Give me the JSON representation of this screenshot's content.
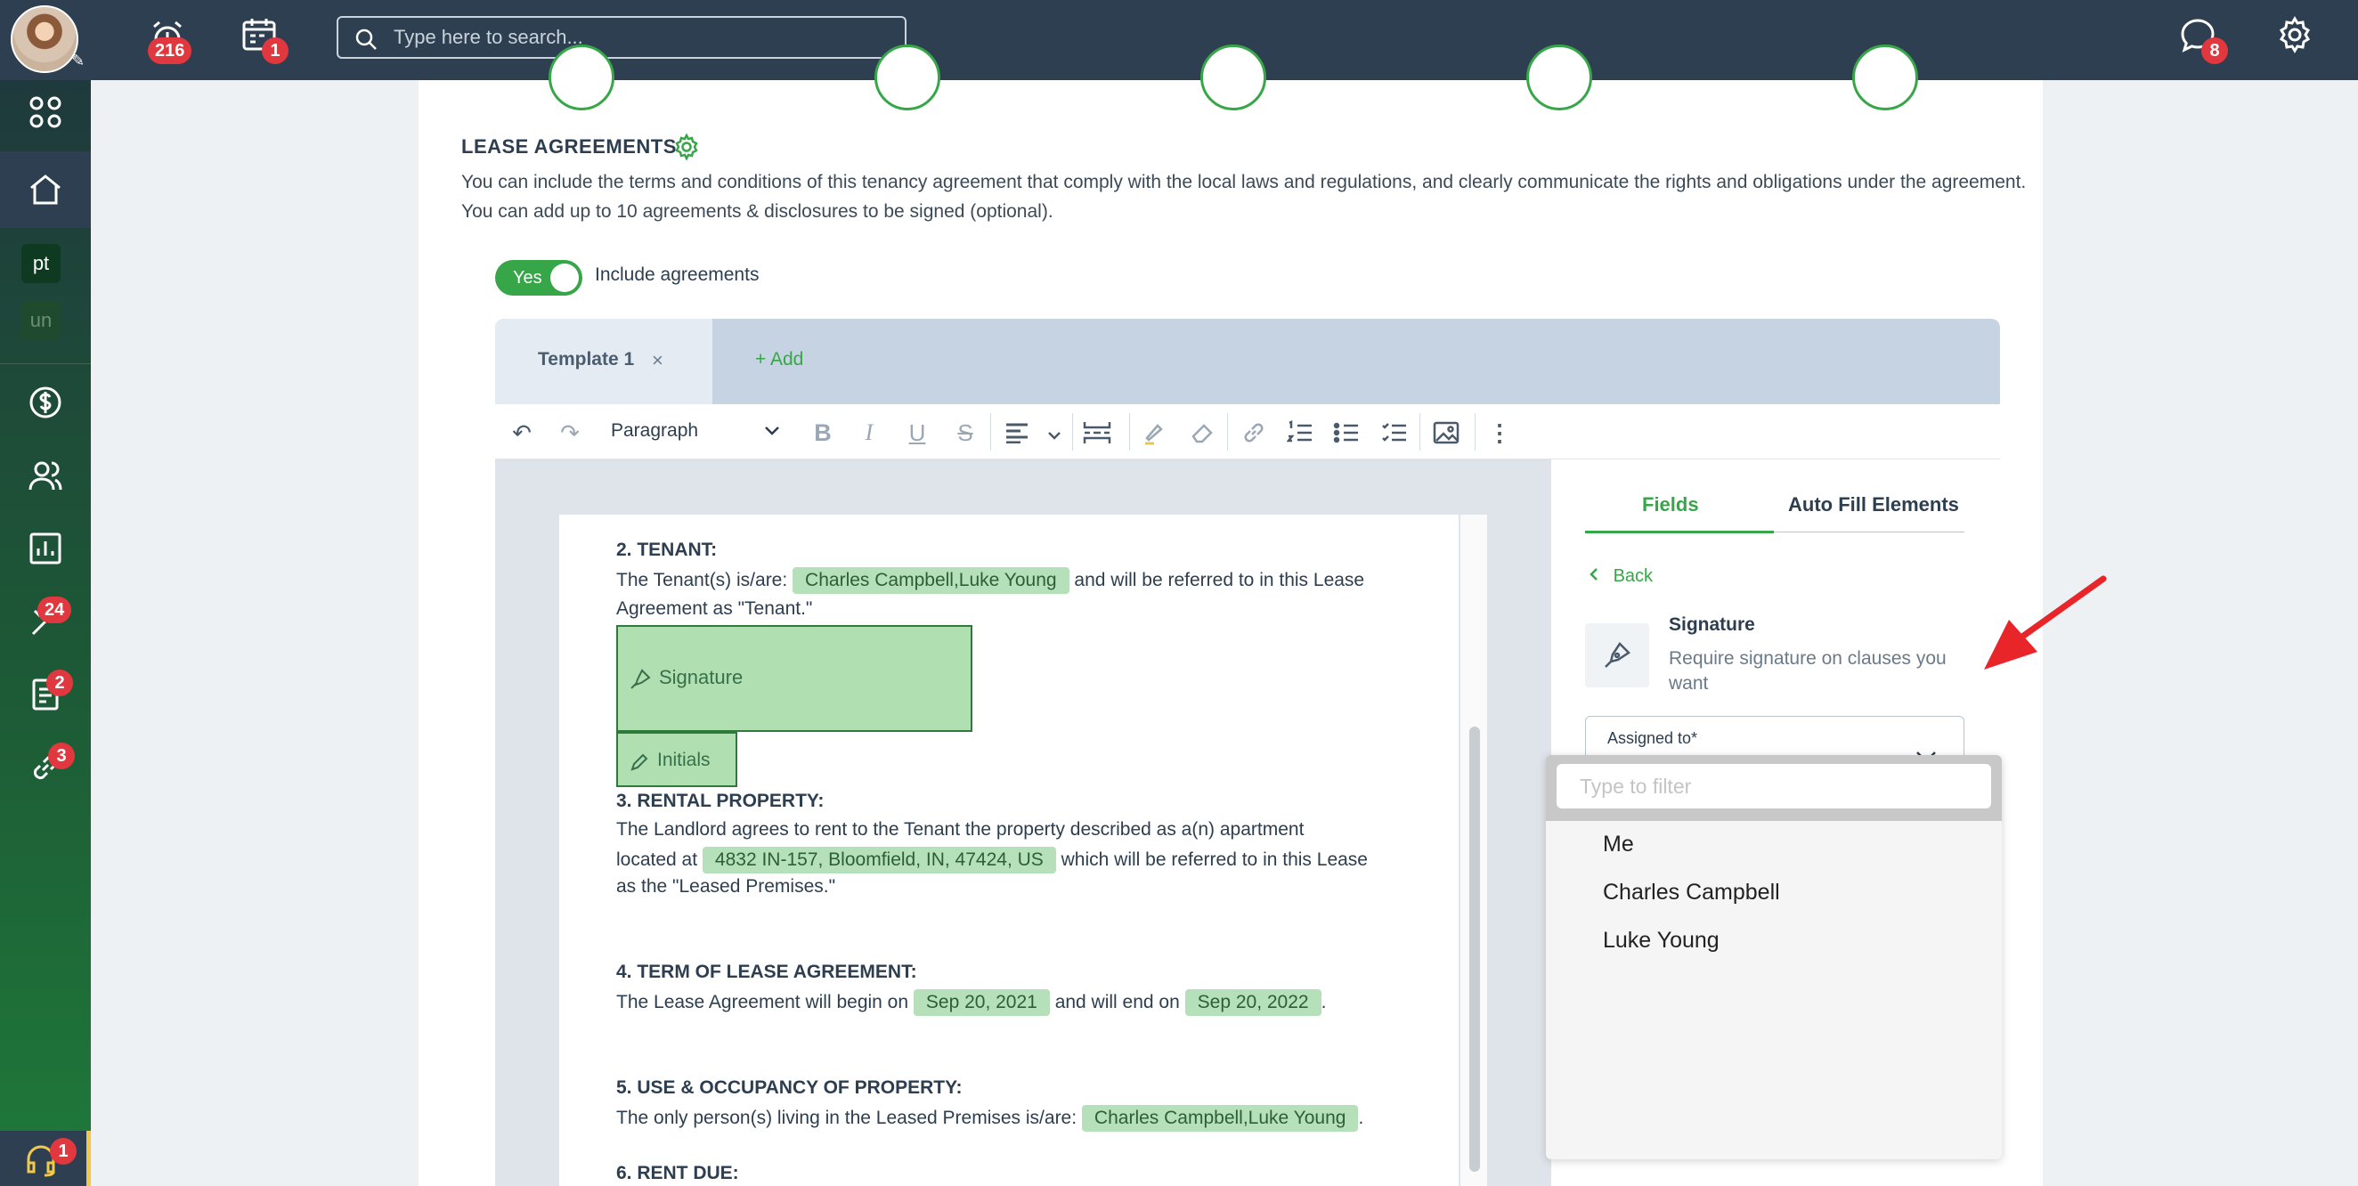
{
  "topbar": {
    "alarm_badge": "216",
    "calendar_badge": "1",
    "search_placeholder": "Type here to search...",
    "chat_badge": "8"
  },
  "sidebar": {
    "pill_pt": "pt",
    "pill_un": "un",
    "tools_badge": "24",
    "docs_badge": "2",
    "links_badge": "3",
    "support_badge": "1"
  },
  "section": {
    "title": "LEASE AGREEMENTS",
    "description": "You can include the terms and conditions of this tenancy agreement that comply with the local laws and regulations, and clearly communicate the rights and obligations under the agreement. You can add up to 10 agreements & disclosures to be signed (optional).",
    "toggle_label": "Yes",
    "include_label": "Include agreements"
  },
  "tabs": {
    "template_label": "Template 1",
    "close_glyph": "×",
    "add_label": "+ Add"
  },
  "toolbar": {
    "paragraph": "Paragraph"
  },
  "doc": {
    "h2": "2. TENANT:",
    "tenant_pre": "The Tenant(s) is/are:",
    "tenant_chip": "Charles Campbell,Luke Young",
    "tenant_post": "and will be referred to in this Lease",
    "tenant_line2": "Agreement as \"Tenant.\"",
    "signature_field": "Signature",
    "initials_field": "Initials",
    "h3": "3. RENTAL PROPERTY:",
    "prop_line1": "The Landlord agrees to rent to the Tenant the property described as a(n) apartment",
    "prop_pre": "located at",
    "prop_chip": "4832 IN-157, Bloomfield, IN, 47424, US",
    "prop_post": "which will be referred to in this Lease",
    "prop_line3": "as the \"Leased Premises.\"",
    "h4": "4. TERM OF LEASE AGREEMENT:",
    "term_pre": "The Lease Agreement will begin on",
    "term_start": "Sep 20, 2021",
    "term_mid": "and will end on",
    "term_end": "Sep 20, 2022",
    "term_post": ".",
    "h5": "5. USE & OCCUPANCY OF PROPERTY:",
    "occ_pre": "The only person(s) living in the Leased Premises is/are:",
    "occ_chip": "Charles Campbell,Luke Young",
    "occ_post": ".",
    "h6": "6. RENT DUE:"
  },
  "panel": {
    "tab_fields": "Fields",
    "tab_auto": "Auto Fill Elements",
    "back": "Back",
    "sig_title": "Signature",
    "sig_desc": "Require signature on clauses you want",
    "assigned_label": "Assigned to*"
  },
  "dropdown": {
    "filter_placeholder": "Type to filter",
    "options": [
      "Me",
      "Charles Campbell",
      "Luke Young"
    ]
  },
  "colors": {
    "accent_green": "#37a648",
    "topbar": "#2d3f50",
    "badge_red": "#e0383e",
    "arrow_red": "#e8262a"
  }
}
